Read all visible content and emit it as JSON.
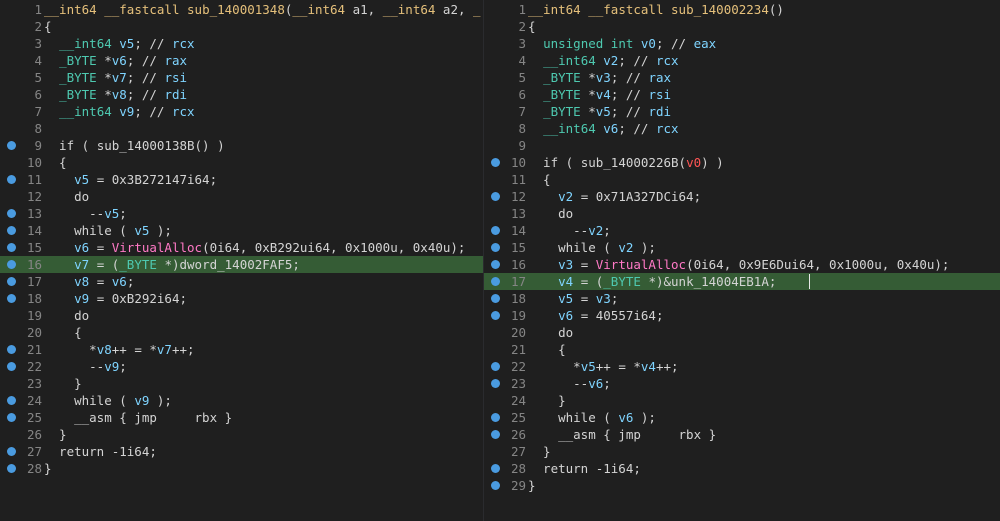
{
  "panes": {
    "left": {
      "lines": [
        {
          "n": "1",
          "dot": false,
          "hl": false,
          "html": "<span class='fn'>__int64</span> <span class='fn'>__fastcall</span> <span class='fn'>sub_140001348</span>(<span class='fn'>__int64</span> a1, <span class='fn'>__int64</span> a2, <span class='fn'>_</span>"
        },
        {
          "n": "2",
          "dot": false,
          "hl": false,
          "html": "{"
        },
        {
          "n": "3",
          "dot": false,
          "hl": false,
          "html": "  <span class='ty'>__int64</span> <span class='var'>v5</span>; // <span class='var'>rcx</span>"
        },
        {
          "n": "4",
          "dot": false,
          "hl": false,
          "html": "  <span class='ty'>_BYTE</span> *<span class='var'>v6</span>; // <span class='var'>rax</span>"
        },
        {
          "n": "5",
          "dot": false,
          "hl": false,
          "html": "  <span class='ty'>_BYTE</span> *<span class='var'>v7</span>; // <span class='var'>rsi</span>"
        },
        {
          "n": "6",
          "dot": false,
          "hl": false,
          "html": "  <span class='ty'>_BYTE</span> *<span class='var'>v8</span>; // <span class='var'>rdi</span>"
        },
        {
          "n": "7",
          "dot": false,
          "hl": false,
          "html": "  <span class='ty'>__int64</span> <span class='var'>v9</span>; // <span class='var'>rcx</span>"
        },
        {
          "n": "8",
          "dot": false,
          "hl": false,
          "html": ""
        },
        {
          "n": "9",
          "dot": true,
          "hl": false,
          "html": "  if ( <span class='kw'>sub_14000138B</span>() )"
        },
        {
          "n": "10",
          "dot": false,
          "hl": false,
          "html": "  {"
        },
        {
          "n": "11",
          "dot": true,
          "hl": false,
          "html": "    <span class='var'>v5</span> = 0x3B272147i64;"
        },
        {
          "n": "12",
          "dot": false,
          "hl": false,
          "html": "    do"
        },
        {
          "n": "13",
          "dot": true,
          "hl": false,
          "html": "      --<span class='var'>v5</span>;"
        },
        {
          "n": "14",
          "dot": true,
          "hl": false,
          "html": "    while ( <span class='var'>v5</span> );"
        },
        {
          "n": "15",
          "dot": true,
          "hl": false,
          "html": "    <span class='var'>v6</span> = <span class='api'>VirtualAlloc</span>(0i64, 0xB292ui64, 0x1000u, 0x40u);"
        },
        {
          "n": "16",
          "dot": true,
          "hl": true,
          "html": "    <span class='var'>v7</span> = (<span class='ty'>_BYTE</span> *)dword_14002FAF5;"
        },
        {
          "n": "17",
          "dot": true,
          "hl": false,
          "html": "    <span class='var'>v8</span> = <span class='var'>v6</span>;"
        },
        {
          "n": "18",
          "dot": true,
          "hl": false,
          "html": "    <span class='var'>v9</span> = 0xB292i64;"
        },
        {
          "n": "19",
          "dot": false,
          "hl": false,
          "html": "    do"
        },
        {
          "n": "20",
          "dot": false,
          "hl": false,
          "html": "    {"
        },
        {
          "n": "21",
          "dot": true,
          "hl": false,
          "html": "      *<span class='var'>v8</span>++ = *<span class='var'>v7</span>++;"
        },
        {
          "n": "22",
          "dot": true,
          "hl": false,
          "html": "      --<span class='var'>v9</span>;"
        },
        {
          "n": "23",
          "dot": false,
          "hl": false,
          "html": "    }"
        },
        {
          "n": "24",
          "dot": true,
          "hl": false,
          "html": "    while ( <span class='var'>v9</span> );"
        },
        {
          "n": "25",
          "dot": true,
          "hl": false,
          "html": "    __asm { jmp     rbx }"
        },
        {
          "n": "26",
          "dot": false,
          "hl": false,
          "html": "  }"
        },
        {
          "n": "27",
          "dot": true,
          "hl": false,
          "html": "  return -1i64;"
        },
        {
          "n": "28",
          "dot": true,
          "hl": false,
          "html": "}"
        }
      ]
    },
    "right": {
      "lines": [
        {
          "n": "1",
          "dot": false,
          "hl": false,
          "html": "<span class='fn'>__int64</span> <span class='fn'>__fastcall</span> <span class='fn'>sub_140002234</span>()"
        },
        {
          "n": "2",
          "dot": false,
          "hl": false,
          "html": "{"
        },
        {
          "n": "3",
          "dot": false,
          "hl": false,
          "html": "  <span class='ty'>unsigned int</span> <span class='var'>v0</span>; // <span class='var'>eax</span>"
        },
        {
          "n": "4",
          "dot": false,
          "hl": false,
          "html": "  <span class='ty'>__int64</span> <span class='var'>v2</span>; // <span class='var'>rcx</span>"
        },
        {
          "n": "5",
          "dot": false,
          "hl": false,
          "html": "  <span class='ty'>_BYTE</span> *<span class='var'>v3</span>; // <span class='var'>rax</span>"
        },
        {
          "n": "6",
          "dot": false,
          "hl": false,
          "html": "  <span class='ty'>_BYTE</span> *<span class='var'>v4</span>; // <span class='var'>rsi</span>"
        },
        {
          "n": "7",
          "dot": false,
          "hl": false,
          "html": "  <span class='ty'>_BYTE</span> *<span class='var'>v5</span>; // <span class='var'>rdi</span>"
        },
        {
          "n": "8",
          "dot": false,
          "hl": false,
          "html": "  <span class='ty'>__int64</span> <span class='var'>v6</span>; // <span class='var'>rcx</span>"
        },
        {
          "n": "9",
          "dot": false,
          "hl": false,
          "html": ""
        },
        {
          "n": "10",
          "dot": true,
          "hl": false,
          "html": "  if ( <span class='kw'>sub_14000226B</span>(<span class='red'>v0</span>) )"
        },
        {
          "n": "11",
          "dot": false,
          "hl": false,
          "html": "  {"
        },
        {
          "n": "12",
          "dot": true,
          "hl": false,
          "html": "    <span class='var'>v2</span> = 0x71A327DCi64;"
        },
        {
          "n": "13",
          "dot": false,
          "hl": false,
          "html": "    do"
        },
        {
          "n": "14",
          "dot": true,
          "hl": false,
          "html": "      --<span class='var'>v2</span>;"
        },
        {
          "n": "15",
          "dot": true,
          "hl": false,
          "html": "    while ( <span class='var'>v2</span> );"
        },
        {
          "n": "16",
          "dot": true,
          "hl": false,
          "html": "    <span class='var'>v3</span> = <span class='api'>VirtualAlloc</span>(0i64, 0x9E6Dui64, 0x1000u, 0x40u);"
        },
        {
          "n": "17",
          "dot": true,
          "hl": true,
          "html": "    <span class='var'>v4</span> = (<span class='ty'>_BYTE</span> *)&amp;unk_14004EB1A;"
        },
        {
          "n": "18",
          "dot": true,
          "hl": false,
          "html": "    <span class='var'>v5</span> = <span class='var'>v3</span>;"
        },
        {
          "n": "19",
          "dot": true,
          "hl": false,
          "html": "    <span class='var'>v6</span> = 40557i64;"
        },
        {
          "n": "20",
          "dot": false,
          "hl": false,
          "html": "    do"
        },
        {
          "n": "21",
          "dot": false,
          "hl": false,
          "html": "    {"
        },
        {
          "n": "22",
          "dot": true,
          "hl": false,
          "html": "      *<span class='var'>v5</span>++ = *<span class='var'>v4</span>++;"
        },
        {
          "n": "23",
          "dot": true,
          "hl": false,
          "html": "      --<span class='var'>v6</span>;"
        },
        {
          "n": "24",
          "dot": false,
          "hl": false,
          "html": "    }"
        },
        {
          "n": "25",
          "dot": true,
          "hl": false,
          "html": "    while ( <span class='var'>v6</span> );"
        },
        {
          "n": "26",
          "dot": true,
          "hl": false,
          "html": "    __asm { jmp     rbx }"
        },
        {
          "n": "27",
          "dot": false,
          "hl": false,
          "html": "  }"
        },
        {
          "n": "28",
          "dot": true,
          "hl": false,
          "html": "  return -1i64;"
        },
        {
          "n": "29",
          "dot": true,
          "hl": false,
          "html": "}"
        }
      ]
    }
  }
}
